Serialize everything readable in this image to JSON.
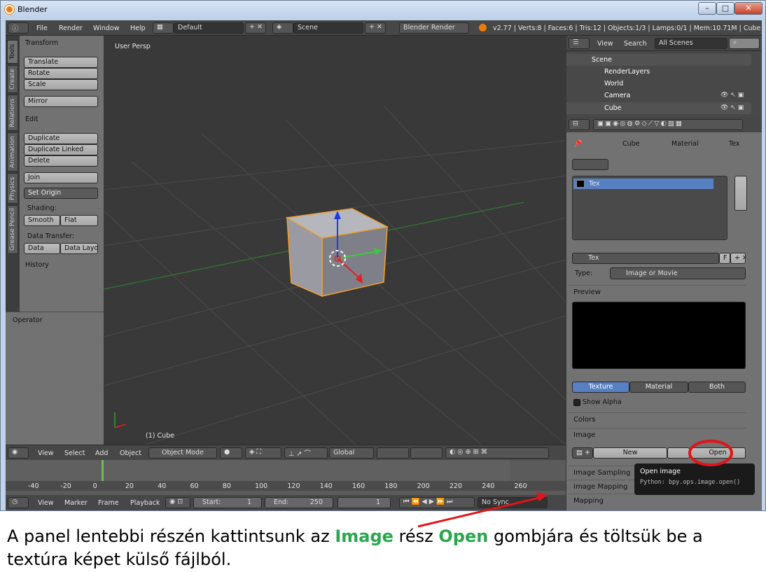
{
  "window": {
    "title": "Blender",
    "min": "–",
    "max": "□",
    "close": "✕"
  },
  "header": {
    "menus": [
      "File",
      "Render",
      "Window",
      "Help"
    ],
    "layout": "Default",
    "scene": "Scene",
    "engine": "Blender Render",
    "stats": "v2.77 | Verts:8 | Faces:6 | Tris:12 | Objects:1/3 | Lamps:0/1 | Mem:10.71M | Cube"
  },
  "tabs": [
    "Tools",
    "Create",
    "Relations",
    "Animation",
    "Physics",
    "Grease Pencil"
  ],
  "tools": {
    "transform": "Transform",
    "translate": "Translate",
    "rotate": "Rotate",
    "scale": "Scale",
    "mirror": "Mirror",
    "edit": "Edit",
    "duplicate": "Duplicate",
    "duplicate_linked": "Duplicate Linked",
    "delete": "Delete",
    "join": "Join",
    "set_origin": "Set Origin",
    "shading": "Shading:",
    "smooth": "Smooth",
    "flat": "Flat",
    "data_transfer": "Data Transfer:",
    "data": "Data",
    "data_layo": "Data Layo",
    "history": "History",
    "operator": "Operator"
  },
  "viewport": {
    "label": "User Persp",
    "object": "(1) Cube"
  },
  "vpheader": {
    "view": "View",
    "select": "Select",
    "add": "Add",
    "object": "Object",
    "mode": "Object Mode",
    "orientation": "Global"
  },
  "timeline": {
    "ticks": [
      "-40",
      "-20",
      "0",
      "20",
      "40",
      "60",
      "80",
      "100",
      "120",
      "140",
      "160",
      "180",
      "200",
      "220",
      "240",
      "260"
    ],
    "view": "View",
    "marker": "Marker",
    "frame": "Frame",
    "playback": "Playback",
    "start_label": "Start:",
    "start": "1",
    "end_label": "End:",
    "end": "250",
    "current": "1",
    "sync": "No Sync"
  },
  "outliner": {
    "view": "View",
    "search": "Search",
    "filter": "All Scenes",
    "items": [
      "Scene",
      "RenderLayers",
      "World",
      "Camera",
      "Cube"
    ]
  },
  "props": {
    "crumb_cube": "Cube",
    "crumb_material": "Material",
    "crumb_tex": "Tex",
    "slot_tex": "Tex",
    "tex_name": "Tex",
    "tex_f": "F",
    "type_label": "Type:",
    "type_value": "Image or Movie",
    "preview": "Preview",
    "texture": "Texture",
    "material": "Material",
    "both": "Both",
    "show_alpha": "Show Alpha",
    "colors": "Colors",
    "image": "Image",
    "new": "New",
    "open": "Open",
    "image_sampling": "Image Sampling",
    "image_mapping": "Image Mapping",
    "mapping": "Mapping"
  },
  "tooltip": {
    "title": "Open image",
    "python": "Python: bpy.ops.image.open()"
  },
  "caption": {
    "part1": "A panel lentebbi részén kattintsunk az ",
    "image": "Image",
    "part2": " rész ",
    "open": "Open",
    "part3": " gombjára és töltsük be a textúra képet külső fájlból."
  },
  "colors": {
    "highlight": "#2aa64e",
    "annotation": "#e0141a",
    "selected": "#5680c2"
  }
}
